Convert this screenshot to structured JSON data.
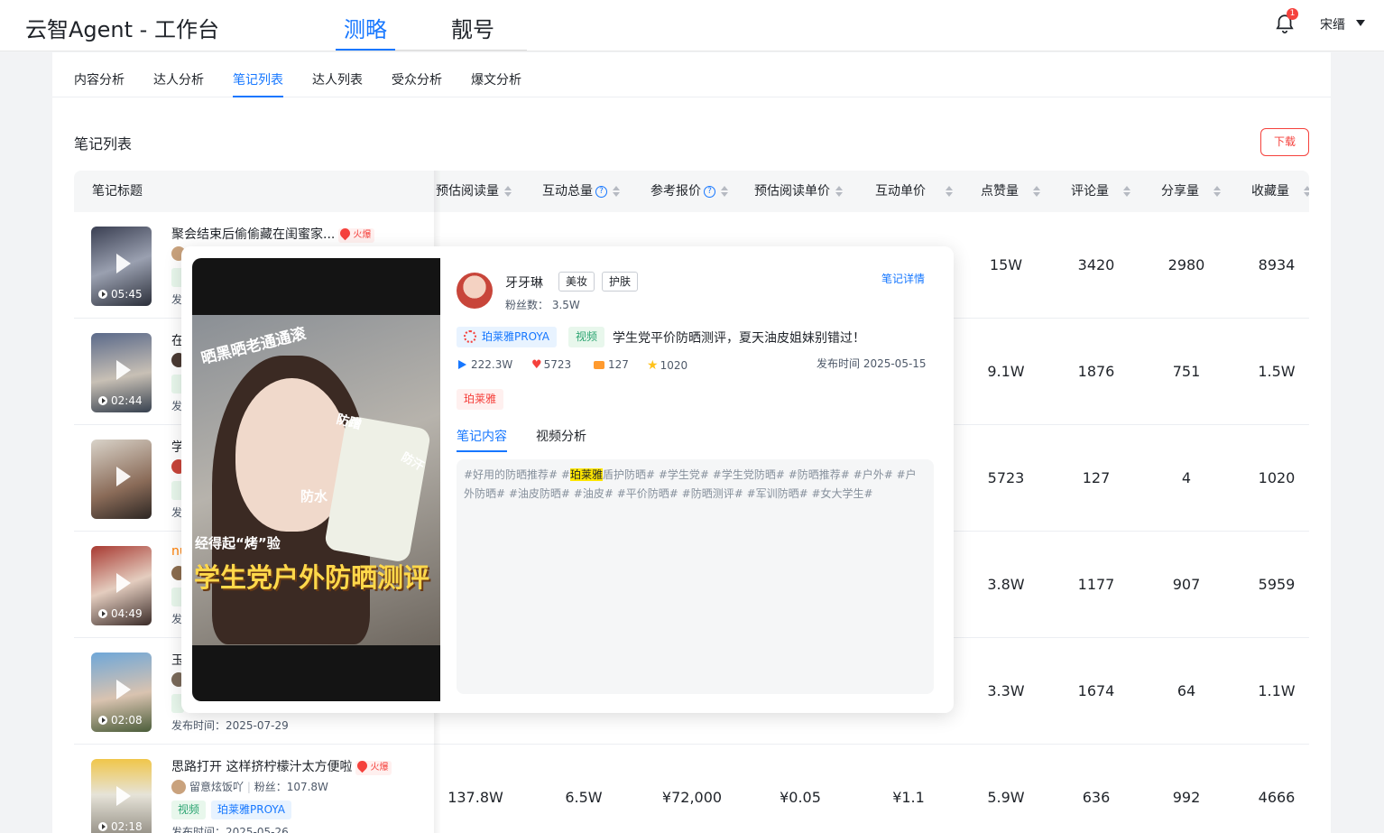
{
  "app": {
    "title": "云智Agent - 工作台",
    "top_tabs": [
      "测略",
      "靓号"
    ],
    "notification_count": "1",
    "user": "宋缙"
  },
  "subtabs": [
    "内容分析",
    "达人分析",
    "笔记列表",
    "达人列表",
    "受众分析",
    "爆文分析"
  ],
  "section": {
    "title": "笔记列表",
    "download_label": "下载"
  },
  "table": {
    "headers": [
      "笔记标题",
      "预估阅读量",
      "互动总量",
      "参考报价",
      "预估阅读单价",
      "互动单价",
      "点赞量",
      "评论量",
      "分享量",
      "收藏量"
    ],
    "question_icon": "?",
    "rows": [
      {
        "title": "聚会结束后偷偷藏在闺蜜家...",
        "hot": "火爆",
        "duration": "05:45",
        "title_visible": true,
        "likes": "15W",
        "comments": "3420",
        "shares": "2980",
        "favorites": "8934"
      },
      {
        "title": "在",
        "duration": "02:44",
        "likes": "9.1W",
        "comments": "1876",
        "shares": "751",
        "favorites": "1.5W"
      },
      {
        "title": "学",
        "duration": "",
        "likes": "5723",
        "comments": "127",
        "shares": "4",
        "favorites": "1020"
      },
      {
        "title": "nu",
        "duration": "04:49",
        "likes": "3.8W",
        "comments": "1177",
        "shares": "907",
        "favorites": "5959"
      },
      {
        "title": "玉",
        "duration": "02:08",
        "pubtime": "发布时间：2025-07-29",
        "likes": "3.3W",
        "comments": "1674",
        "shares": "64",
        "favorites": "1.1W"
      },
      {
        "title": "思路打开 这样挤柠檬汁太方便啦",
        "hot": "火爆",
        "duration": "02:18",
        "author": "留意炫饭吖",
        "fans": "粉丝：107.8W",
        "tag_video": "视频",
        "tag_brand": "珀莱雅PROYA",
        "pubtime": "发布时间：2025-05-26",
        "reads": "137.8W",
        "interactions": "6.5W",
        "price": "¥72,000",
        "read_unit": "¥0.05",
        "inter_unit": "¥1.1",
        "likes": "5.9W",
        "comments": "636",
        "shares": "992",
        "favorites": "4666"
      }
    ],
    "partial_pub_label": "发"
  },
  "popup": {
    "author_name": "牙牙琳",
    "tags": [
      "美妆",
      "护肤"
    ],
    "fans": "粉丝数： 3.5W",
    "detail_link": "笔记详情",
    "brand_tag": "珀莱雅PROYA",
    "video_tag": "视频",
    "title": "学生党平价防晒测评，夏天油皮姐妹别错过！",
    "stats": {
      "plays": "222.3W",
      "likes": "5723",
      "comments": "127",
      "favorites": "1020"
    },
    "pubtime": "发布时间 2025-05-15",
    "keyword": "珀莱雅",
    "tabs": [
      "笔记内容",
      "视频分析"
    ],
    "content_before": "#好用的防晒推荐# #",
    "content_highlight": "珀莱雅",
    "content_after": "盾护防晒# #学生党# #学生党防晒# #防晒推荐# #户外# #户外防晒# #油皮防晒# #油皮# #平价防晒# #防晒测评# #军训防晒# #女大学生#",
    "video_texts": {
      "t1": "晒黑晒老通通滚",
      "t2": "经得起“烤”验",
      "t3": "学生党户外防晒测评",
      "t4": "防水",
      "t5": "防蹭",
      "t6": "防汗"
    }
  },
  "colors": {
    "accent": "#1677ff",
    "danger": "#f5413c",
    "success": "#2ba471"
  }
}
